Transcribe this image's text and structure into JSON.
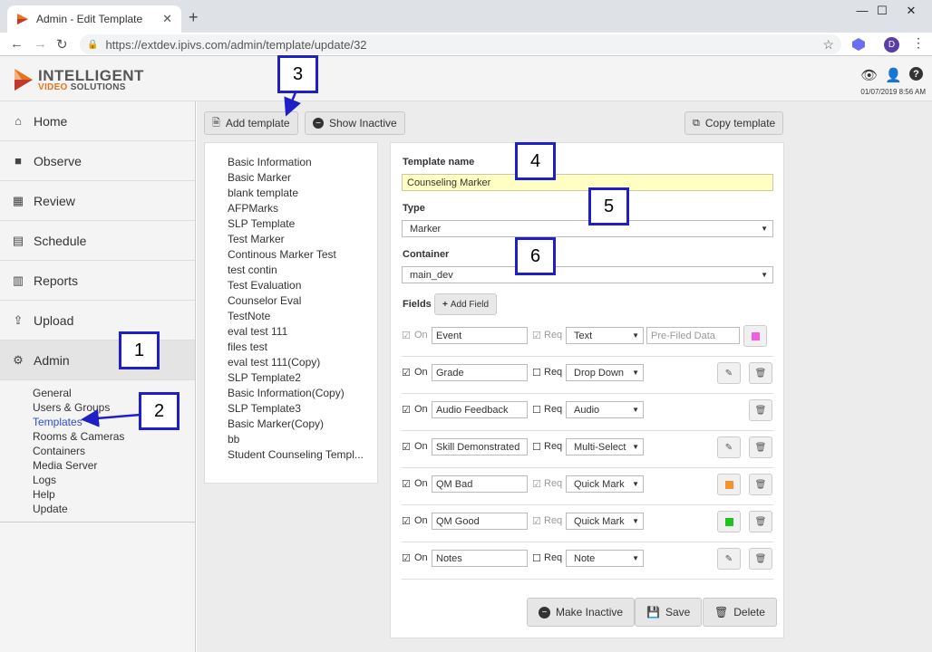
{
  "browser": {
    "tab_title": "Admin - Edit Template",
    "tab_close": "✕",
    "new_tab": "+",
    "url": "https://extdev.ipivs.com/admin/template/update/32",
    "profile_initial": "D",
    "window_controls": [
      "—",
      "☐",
      "✕"
    ]
  },
  "header": {
    "logo_line1": "INTELLIGENT",
    "logo_line2a": "VIDEO",
    "logo_line2b": " SOLUTIONS",
    "datetime": "01/07/2019 8:56 AM"
  },
  "sidebar": {
    "items": [
      {
        "label": "Home",
        "icon": "home-icon"
      },
      {
        "label": "Observe",
        "icon": "video-camera-icon"
      },
      {
        "label": "Review",
        "icon": "film-icon"
      },
      {
        "label": "Schedule",
        "icon": "calendar-icon"
      },
      {
        "label": "Reports",
        "icon": "bar-chart-icon"
      },
      {
        "label": "Upload",
        "icon": "upload-icon"
      },
      {
        "label": "Admin",
        "icon": "gear-icon"
      }
    ],
    "admin_sub": [
      "General",
      "Users & Groups",
      "Templates",
      "Rooms & Cameras",
      "Containers",
      "Media Server",
      "Logs",
      "Help",
      "Update"
    ]
  },
  "toolbar": {
    "add_template": "Add template",
    "show_inactive": "Show Inactive",
    "copy_template": "Copy template"
  },
  "templates": [
    "Basic Information",
    "Basic Marker",
    "blank template",
    "AFPMarks",
    "SLP Template",
    "Test Marker",
    "Continous Marker Test",
    "test contin",
    "Test Evaluation",
    "Counselor Eval",
    "TestNote",
    "eval test 111",
    "files test",
    "eval test 111(Copy)",
    "SLP Template2",
    "Basic Information(Copy)",
    "SLP Template3",
    "Basic Marker(Copy)",
    "bb",
    "Student Counseling Templ..."
  ],
  "form": {
    "name_label": "Template name",
    "name_value": "Counseling Marker",
    "type_label": "Type",
    "type_value": "Marker",
    "container_label": "Container",
    "container_value": "main_dev",
    "fields_label": "Fields",
    "add_field": "Add Field",
    "on_label": "On",
    "req_label": "Req",
    "prefill_placeholder": "Pre-Filed Data",
    "fields": [
      {
        "name": "Event",
        "type": "Text",
        "req": true,
        "locked": true,
        "color": "#f05ee0"
      },
      {
        "name": "Grade",
        "type": "Drop Down",
        "req": false
      },
      {
        "name": "Audio Feedback",
        "type": "Audio",
        "req": false
      },
      {
        "name": "Skill Demonstrated",
        "type": "Multi-Select",
        "req": false
      },
      {
        "name": "QM Bad",
        "type": "Quick Mark",
        "req": true,
        "color": "#f5922e"
      },
      {
        "name": "QM Good",
        "type": "Quick Mark",
        "req": true,
        "color": "#1ec41e"
      },
      {
        "name": "Notes",
        "type": "Note",
        "req": false
      }
    ],
    "make_inactive": "Make Inactive",
    "save": "Save",
    "delete": "Delete"
  },
  "annotations": [
    "1",
    "2",
    "3",
    "4",
    "5",
    "6"
  ]
}
